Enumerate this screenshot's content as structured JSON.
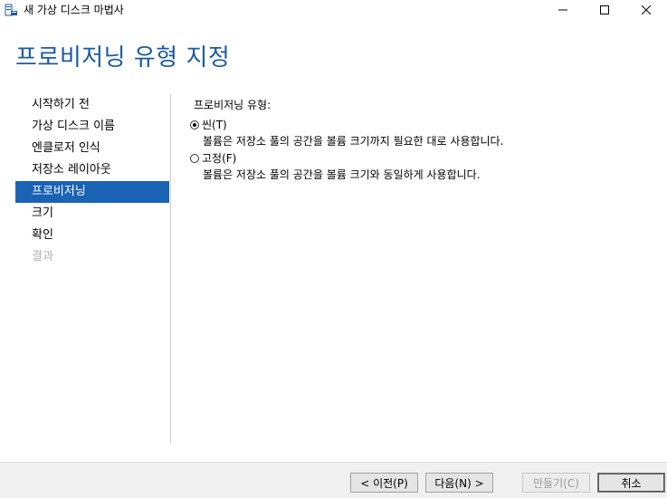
{
  "window": {
    "title": "새 가상 디스크 마법사"
  },
  "header": {
    "title": "프로비저닝 유형 지정"
  },
  "nav": {
    "items": [
      {
        "label": "시작하기 전",
        "state": "normal"
      },
      {
        "label": "가상 디스크 이름",
        "state": "normal"
      },
      {
        "label": "엔클로저 인식",
        "state": "normal"
      },
      {
        "label": "저장소 레이아웃",
        "state": "normal"
      },
      {
        "label": "프로비저닝",
        "state": "active"
      },
      {
        "label": "크기",
        "state": "normal"
      },
      {
        "label": "확인",
        "state": "normal"
      },
      {
        "label": "결과",
        "state": "disabled"
      }
    ]
  },
  "content": {
    "section_label": "프로비저닝 유형:",
    "options": [
      {
        "label": "씬(T)",
        "checked": true,
        "description": "볼륨은 저장소 풀의 공간을 볼륨 크기까지 필요한 대로 사용합니다."
      },
      {
        "label": "고정(F)",
        "checked": false,
        "description": "볼륨은 저장소 풀의 공간을 볼륨 크기와 동일하게 사용합니다."
      }
    ]
  },
  "footer": {
    "prev_label": "< 이전(P)",
    "next_label": "다음(N) >",
    "create_label": "만들기(C)",
    "cancel_label": "취소"
  },
  "colors": {
    "accent": "#1a63b5",
    "header_text": "#1c5aa0"
  },
  "icons": {
    "app": "storage-wizard-icon",
    "minimize": "minimize-icon",
    "maximize": "maximize-icon",
    "close": "close-icon"
  }
}
